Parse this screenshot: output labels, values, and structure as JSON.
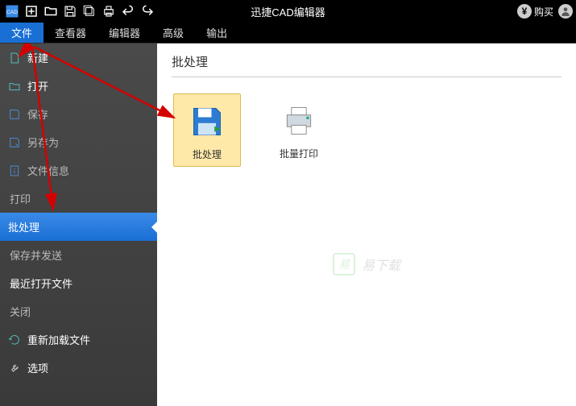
{
  "titlebar": {
    "title": "迅捷CAD编辑器",
    "buy_label": "购买"
  },
  "menubar": {
    "items": [
      {
        "label": "文件",
        "active": true
      },
      {
        "label": "查看器",
        "active": false
      },
      {
        "label": "编辑器",
        "active": false
      },
      {
        "label": "高级",
        "active": false
      },
      {
        "label": "输出",
        "active": false
      }
    ]
  },
  "sidebar": {
    "items": [
      {
        "label": "新建",
        "icon": "file-new-icon",
        "bright": true
      },
      {
        "label": "打开",
        "icon": "folder-open-icon",
        "bright": true
      },
      {
        "label": "保存",
        "icon": "save-icon",
        "bright": false
      },
      {
        "label": "另存为",
        "icon": "save-as-icon",
        "bright": false
      },
      {
        "label": "文件信息",
        "icon": "file-info-icon",
        "bright": false
      },
      {
        "label": "打印",
        "icon": null,
        "bright": false
      },
      {
        "label": "批处理",
        "icon": null,
        "bright": true,
        "active": true
      },
      {
        "label": "保存并发送",
        "icon": null,
        "bright": false
      },
      {
        "label": "最近打开文件",
        "icon": null,
        "bright": true
      },
      {
        "label": "关闭",
        "icon": null,
        "bright": false
      },
      {
        "label": "重新加载文件",
        "icon": "reload-icon",
        "bright": true
      },
      {
        "label": "选项",
        "icon": "wrench-icon",
        "bright": true
      }
    ]
  },
  "content": {
    "title": "批处理",
    "items": [
      {
        "label": "批处理",
        "icon": "batch-save-icon",
        "selected": true
      },
      {
        "label": "批量打印",
        "icon": "batch-print-icon",
        "selected": false
      }
    ]
  },
  "watermark": {
    "text": "易下载"
  },
  "colors": {
    "accent": "#1a6fd4",
    "titlebar": "#000000",
    "sidebar": "#3a3a3a"
  }
}
